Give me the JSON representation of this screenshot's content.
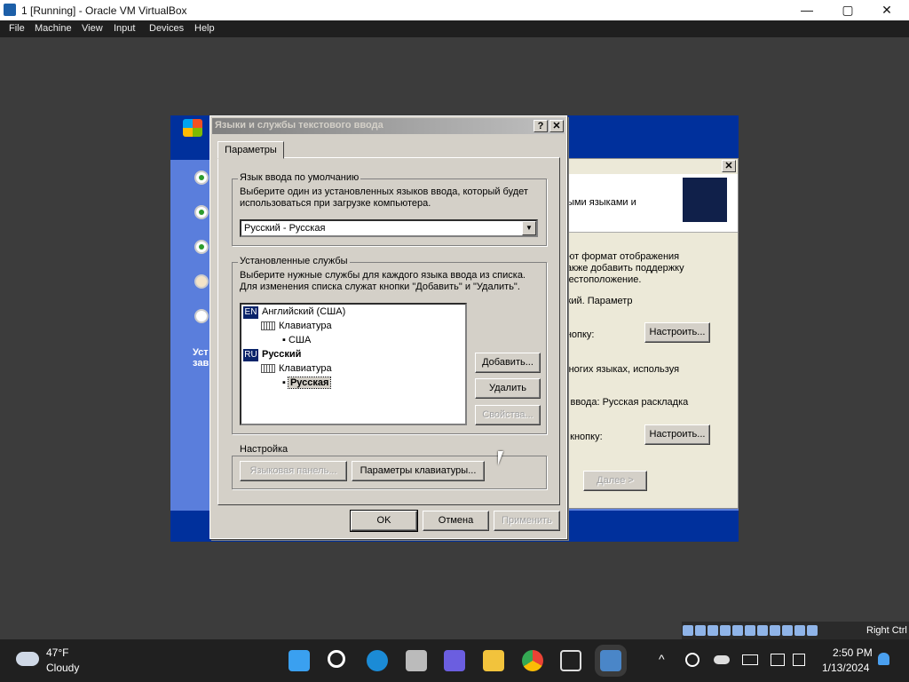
{
  "host": {
    "title": "1 [Running] - Oracle VM VirtualBox",
    "menu": [
      "File",
      "Machine",
      "View",
      "Input",
      "Devices",
      "Help"
    ],
    "controls": {
      "minimize": "—",
      "maximize": "▢",
      "close": "✕"
    }
  },
  "guest_bg": {
    "side_text": [
      "Уст",
      "зав"
    ],
    "dialog_text": {
      "header": "ными языками и",
      "l1": "ают формат отображения",
      "l2": "также добавить поддержку",
      "l3": " местоположение.",
      "l4": "ский. Параметр",
      "l5": "кнопку:",
      "l6": "многих языках, используя",
      "l7": "д ввода: Русская раскладка",
      "l8": "е кнопку:",
      "configure": "Настроить...",
      "next": "Далее >"
    }
  },
  "dialog": {
    "title": "Языки и службы текстового ввода",
    "help": "?",
    "close": "✕",
    "tab": "Параметры",
    "default_group": {
      "label": "Язык ввода по умолчанию",
      "desc1": "Выберите один из установленных языков ввода, который будет",
      "desc2": "использоваться при загрузке компьютера.",
      "selected": "Русский - Русская"
    },
    "services_group": {
      "label": "Установленные службы",
      "desc1": "Выберите нужные службы для каждого языка ввода из списка.",
      "desc2": "Для изменения списка служат кнопки \"Добавить\" и \"Удалить\".",
      "tree": {
        "en_code": "EN",
        "en_name": "Английский (США)",
        "en_kb": "Клавиатура",
        "en_layout": "США",
        "ru_code": "RU",
        "ru_name": "Русский",
        "ru_kb": "Клавиатура",
        "ru_layout": "Русская"
      },
      "add": "Добавить...",
      "remove": "Удалить",
      "properties": "Свойства..."
    },
    "settings_group": {
      "label": "Настройка",
      "langbar": "Языковая панель...",
      "keyboard": "Параметры клавиатуры..."
    },
    "ok": "OK",
    "cancel": "Отмена",
    "apply": "Применить"
  },
  "tray": {
    "right_ctrl": "Right Ctrl"
  },
  "taskbar": {
    "temp": "47°F",
    "weather": "Cloudy",
    "time": "2:50 PM",
    "date": "1/13/2024"
  },
  "colors": {
    "xp_blue": "#00309c",
    "xp_mid": "#5a7edc",
    "dialog": "#d4d0c8",
    "selection": "#0a246a"
  }
}
